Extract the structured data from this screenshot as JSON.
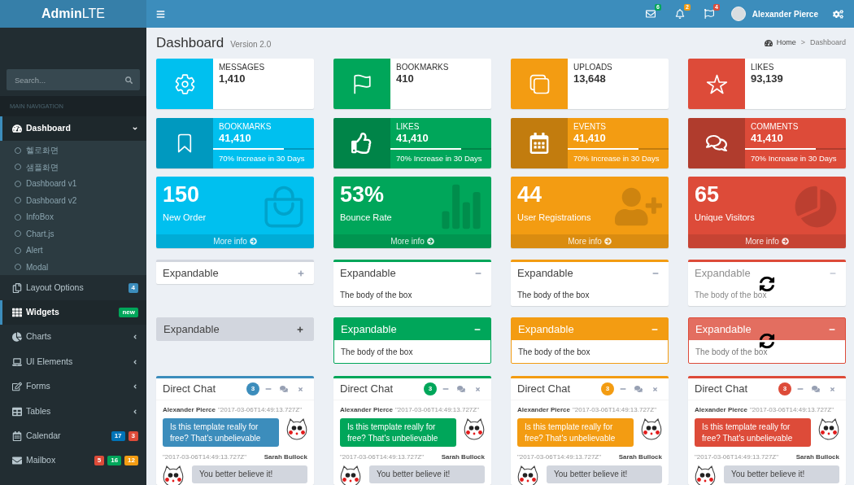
{
  "logo": {
    "text": "**Admin**LTE"
  },
  "navbar": {
    "notifications": [
      {
        "badge": "6",
        "color": "#00a65a"
      },
      {
        "badge": "2",
        "color": "#f39c12"
      },
      {
        "badge": "4",
        "color": "#dd4b39"
      }
    ],
    "user": {
      "name": "Alexander Pierce"
    }
  },
  "sidebar": {
    "search": {
      "placeholder": "Search..."
    },
    "header": "MAIN NAVIGATION",
    "items": [
      {
        "kind": "tree",
        "label": "Dashboard",
        "selected": true,
        "expanded": true,
        "children": [
          {
            "label": "헬로화면",
            "selected": false
          },
          {
            "label": "샘플화면",
            "selected": false
          },
          {
            "label": "Dashboard v1",
            "selected": false
          },
          {
            "label": "Dashboard v2",
            "selected": false
          },
          {
            "label": "InfoBox",
            "selected": false
          },
          {
            "label": "Chart.js",
            "selected": false
          },
          {
            "label": "Alert",
            "selected": false
          },
          {
            "label": "Modal",
            "selected": false
          }
        ]
      },
      {
        "kind": "link",
        "label": "Layout Options",
        "selected": false,
        "badges": [
          {
            "text": "4",
            "color": "#3c8dbc"
          }
        ]
      },
      {
        "kind": "link",
        "label": "Widgets",
        "selected": true,
        "badges": [
          {
            "text": "new",
            "color": "#00a65a"
          }
        ]
      },
      {
        "kind": "tree",
        "label": "Charts",
        "selected": false,
        "expanded": false
      },
      {
        "kind": "tree",
        "label": "UI Elements",
        "selected": false,
        "expanded": false
      },
      {
        "kind": "tree",
        "label": "Forms",
        "selected": false,
        "expanded": false
      },
      {
        "kind": "tree",
        "label": "Tables",
        "selected": false,
        "expanded": false
      },
      {
        "kind": "link",
        "label": "Calendar",
        "selected": false,
        "badges": [
          {
            "text": "17",
            "color": "#0073b7"
          },
          {
            "text": "3",
            "color": "#dd4b39"
          }
        ]
      },
      {
        "kind": "link",
        "label": "Mailbox",
        "selected": false,
        "badges": [
          {
            "text": "5",
            "color": "#dd4b39"
          },
          {
            "text": "16",
            "color": "#00a65a"
          },
          {
            "text": "12",
            "color": "#f39c12"
          }
        ]
      }
    ]
  },
  "content_header": {
    "title": "Dashboard",
    "subtitle": "Version 2.0"
  },
  "breadcrumb": {
    "items": [
      {
        "label": "Home"
      },
      {
        "label": "Dashboard"
      }
    ],
    "separator": ">"
  },
  "info_boxes": [
    {
      "label": "MESSAGES",
      "value": "1,410",
      "color": "#00c0ef"
    },
    {
      "label": "BOOKMARKS",
      "value": "410",
      "color": "#00a65a"
    },
    {
      "label": "UPLOADS",
      "value": "13,648",
      "color": "#f39c12"
    },
    {
      "label": "LIKES",
      "value": "93,139",
      "color": "#dd4b39"
    }
  ],
  "progress_boxes": [
    {
      "label": "BOOKMARKS",
      "value": "41,410",
      "level": 0.7,
      "description": "70% Increase in 30 Days",
      "color": "#00c0ef"
    },
    {
      "label": "LIKES",
      "value": "41,410",
      "level": 0.7,
      "description": "70% Increase in 30 Days",
      "color": "#00a65a"
    },
    {
      "label": "EVENTS",
      "value": "41,410",
      "level": 0.7,
      "description": "70% Increase in 30 Days",
      "color": "#f39c12"
    },
    {
      "label": "COMMENTS",
      "value": "41,410",
      "level": 0.7,
      "description": "70% Increase in 30 Days",
      "color": "#dd4b39"
    }
  ],
  "small_boxes": [
    {
      "value": "150",
      "label": "New Order",
      "link": "More info",
      "color": "#00c0ef"
    },
    {
      "value": "53%",
      "label": "Bounce Rate",
      "link": "More info",
      "color": "#00a65a"
    },
    {
      "value": "44",
      "label": "User Registrations",
      "link": "More info",
      "color": "#f39c12"
    },
    {
      "value": "65",
      "label": "Unique Visitors",
      "link": "More info",
      "color": "#dd4b39"
    }
  ],
  "expandable_boxes": [
    {
      "title": "Expandable",
      "expanded": false,
      "loading": false,
      "color": "#d2d6de"
    },
    {
      "title": "Expandable",
      "body": "The body of the box",
      "expanded": true,
      "loading": false,
      "color": "#00a65a"
    },
    {
      "title": "Expandable",
      "body": "The body of the box",
      "expanded": true,
      "loading": false,
      "color": "#f39c12"
    },
    {
      "title": "Expandable",
      "body": "The body of the box",
      "expanded": true,
      "loading": true,
      "color": "#dd4b39"
    }
  ],
  "solid_boxes": [
    {
      "title": "Expandable",
      "expanded": false,
      "loading": false,
      "color": "#d2d6de"
    },
    {
      "title": "Expandable",
      "body": "The body of the box",
      "expanded": true,
      "loading": false,
      "color": "#00a65a"
    },
    {
      "title": "Expandable",
      "body": "The body of the box",
      "expanded": true,
      "loading": false,
      "color": "#f39c12"
    },
    {
      "title": "Expandable",
      "body": "The body of the box",
      "expanded": true,
      "loading": true,
      "color": "#dd4b39"
    }
  ],
  "chat_boxes": [
    {
      "title": "Direct Chat",
      "badge": "3",
      "color": "#3c8dbc",
      "messages": [
        {
          "kind": "left",
          "name": "Alexander Pierce",
          "timestamp": "\"2017-03-06T14:49:13.727Z\"",
          "text": "Is this template really for free? That's unbelievable"
        },
        {
          "kind": "right",
          "name": "Sarah Bullock",
          "timestamp": "\"2017-03-06T14:49:13.727Z\"",
          "text": "You better believe it!"
        }
      ]
    },
    {
      "title": "Direct Chat",
      "badge": "3",
      "color": "#00a65a",
      "messages": [
        {
          "kind": "left",
          "name": "Alexander Pierce",
          "timestamp": "\"2017-03-06T14:49:13.727Z\"",
          "text": "Is this template really for free? That's unbelievable"
        },
        {
          "kind": "right",
          "name": "Sarah Bullock",
          "timestamp": "\"2017-03-06T14:49:13.727Z\"",
          "text": "You better believe it!"
        }
      ]
    },
    {
      "title": "Direct Chat",
      "badge": "3",
      "color": "#f39c12",
      "messages": [
        {
          "kind": "left",
          "name": "Alexander Pierce",
          "timestamp": "\"2017-03-06T14:49:13.727Z\"",
          "text": "Is this template really for free? That's unbelievable"
        },
        {
          "kind": "right",
          "name": "Sarah Bullock",
          "timestamp": "\"2017-03-06T14:49:13.727Z\"",
          "text": "You better believe it!"
        }
      ]
    },
    {
      "title": "Direct Chat",
      "badge": "3",
      "color": "#dd4b39",
      "messages": [
        {
          "kind": "left",
          "name": "Alexander Pierce",
          "timestamp": "\"2017-03-06T14:49:13.727Z\"",
          "text": "Is this template really for free? That's unbelievable"
        },
        {
          "kind": "right",
          "name": "Sarah Bullock",
          "timestamp": "\"2017-03-06T14:49:13.727Z\"",
          "text": "You better believe it!"
        }
      ]
    }
  ]
}
